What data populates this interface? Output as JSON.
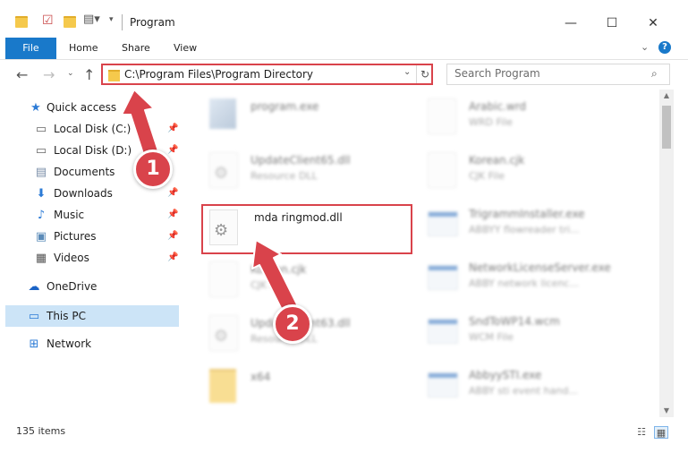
{
  "window": {
    "title": "Program",
    "minimize_glyph": "—",
    "maximize_glyph": "☐",
    "close_glyph": "✕"
  },
  "ribbon": {
    "tabs": [
      "File",
      "Home",
      "Share",
      "View"
    ],
    "help_glyph": "?"
  },
  "address": {
    "path": "C:\\Program Files\\Program Directory",
    "search_placeholder": "Search Program"
  },
  "sidebar": {
    "items": [
      {
        "label": "Quick access",
        "icon": "star-icon"
      },
      {
        "label": "Local Disk (C:)",
        "icon": "drive-icon",
        "pinned": true
      },
      {
        "label": "Local Disk (D:)",
        "icon": "drive-icon",
        "pinned": true
      },
      {
        "label": "Documents",
        "icon": "documents-icon",
        "pinned": true
      },
      {
        "label": "Downloads",
        "icon": "downloads-icon",
        "pinned": true
      },
      {
        "label": "Music",
        "icon": "music-icon",
        "pinned": true
      },
      {
        "label": "Pictures",
        "icon": "pictures-icon",
        "pinned": true
      },
      {
        "label": "Videos",
        "icon": "videos-icon",
        "pinned": true
      },
      {
        "label": "OneDrive",
        "icon": "onedrive-icon"
      },
      {
        "label": "This PC",
        "icon": "pc-icon",
        "selected": true
      },
      {
        "label": "Network",
        "icon": "network-icon"
      }
    ]
  },
  "files": {
    "left": [
      {
        "name": "program.exe",
        "type": ""
      },
      {
        "name": "UpdateClient65.dll",
        "type": "Resource DLL"
      },
      {
        "name": "mda ringmod.dll",
        "type": "",
        "highlighted": true
      },
      {
        "name": "Korean.cjk",
        "type": "CJK File"
      },
      {
        "name": "UpdateClient63.dll",
        "type": "Resource DLL"
      },
      {
        "name": "x64",
        "type": ""
      }
    ],
    "right": [
      {
        "name": "Arabic.wrd",
        "type": "WRD File"
      },
      {
        "name": "Korean.cjk",
        "type": "CJK File"
      },
      {
        "name": "TrigrammInstaller.exe",
        "type": "ABBYY flowreader tri..."
      },
      {
        "name": "NetworkLicenseServer.exe",
        "type": "ABBY network licenc..."
      },
      {
        "name": "SndToWP14.wcm",
        "type": "WCM File"
      },
      {
        "name": "AbbyySTI.exe",
        "type": "ABBY sti event hand..."
      }
    ]
  },
  "status": {
    "item_count": "135 items"
  },
  "steps": {
    "step1": "1",
    "step2": "2"
  },
  "colors": {
    "accent": "#1979ca",
    "callout": "#d9434b",
    "selection": "#cce4f7"
  }
}
